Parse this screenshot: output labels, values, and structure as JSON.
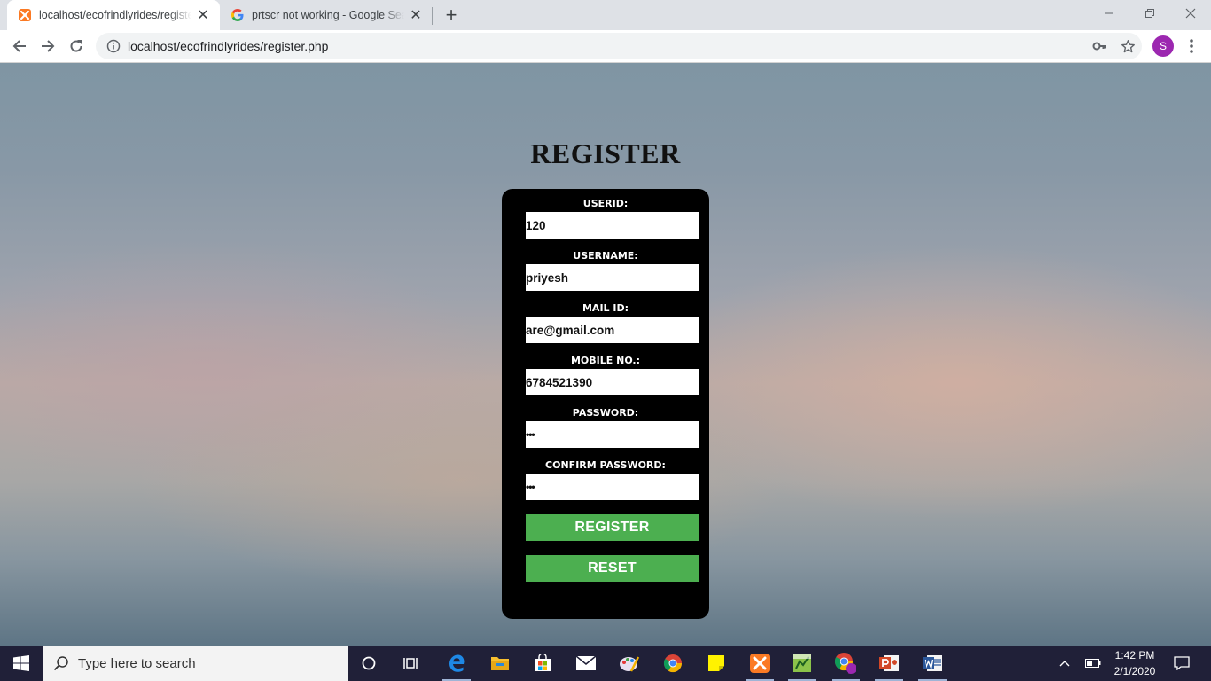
{
  "browser": {
    "tabs": [
      {
        "title": "localhost/ecofrindlyrides/register.php",
        "favicon": "xampp-icon",
        "active": true
      },
      {
        "title": "prtscr not working - Google Search",
        "favicon": "google-icon",
        "active": false
      }
    ],
    "url": "localhost/ecofrindlyrides/register.php",
    "profile_initial": "S"
  },
  "page": {
    "title": "REGISTER",
    "form": {
      "fields": [
        {
          "label": "USERID:",
          "value": "120"
        },
        {
          "label": "USERNAME:",
          "value": "priyesh"
        },
        {
          "label": "MAIL ID:",
          "value": "are@gmail.com"
        },
        {
          "label": "MOBILE NO.:",
          "value": "6784521390"
        },
        {
          "label": "PASSWORD:",
          "value": "•••"
        },
        {
          "label": "CONFIRM PASSWORD:",
          "value": "•••"
        }
      ],
      "register_button": "REGISTER",
      "reset_button": "RESET",
      "button_color": "#4caf50"
    }
  },
  "taskbar": {
    "search_placeholder": "Type here to search",
    "time": "1:42 PM",
    "date": "2/1/2020",
    "apps": [
      "cortana-icon",
      "task-view-icon",
      "edge-icon",
      "file-explorer-icon",
      "store-icon",
      "mail-icon",
      "paint-icon",
      "chrome-icon",
      "sticky-notes-icon",
      "xampp-icon",
      "sublime-icon",
      "chrome-profile-icon",
      "powerpoint-icon",
      "word-icon"
    ]
  }
}
